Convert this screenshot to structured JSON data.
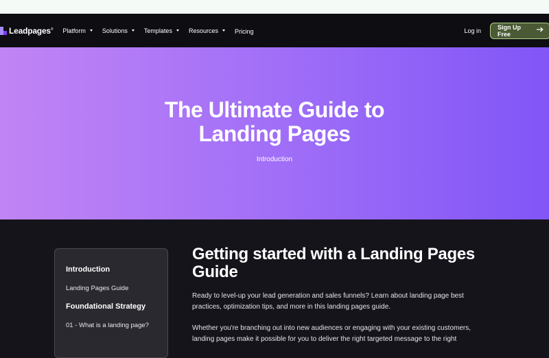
{
  "nav": {
    "logo": "Leadpages",
    "logo_mark": "®",
    "items": [
      {
        "label": "Platform",
        "has_dropdown": true
      },
      {
        "label": "Solutions",
        "has_dropdown": true
      },
      {
        "label": "Templates",
        "has_dropdown": true
      },
      {
        "label": "Resources",
        "has_dropdown": true
      },
      {
        "label": "Pricing",
        "has_dropdown": false
      }
    ],
    "login": "Log in",
    "signup": "Sign Up Free",
    "signup_icon": "arrow-right-icon"
  },
  "hero": {
    "title_line1": "The Ultimate Guide to",
    "title_line2": "Landing Pages",
    "breadcrumb": "Introduction"
  },
  "sidebar": {
    "items": [
      {
        "label": "Introduction",
        "type": "heading"
      },
      {
        "label": "Landing Pages Guide",
        "type": "link"
      },
      {
        "label": "Foundational Strategy",
        "type": "heading"
      },
      {
        "label": "01 - What is a landing page?",
        "type": "link"
      }
    ]
  },
  "article": {
    "title": "Getting started with a Landing Pages Guide",
    "para1": "Ready to level-up your lead generation and sales funnels? Learn about landing page best practices, optimization tips, and more in this landing pages guide.",
    "para2": "Whether you're branching out into new audiences or engaging with your existing customers, landing pages make it possible for you to deliver the right targeted message to the right"
  },
  "colors": {
    "hero_start": "#c184f4",
    "hero_end": "#8156f7",
    "signup_bg": "#4a5a34",
    "signup_border": "#b7d38d",
    "nav_bg": "#0e0d12",
    "body_bg": "#16141b"
  }
}
